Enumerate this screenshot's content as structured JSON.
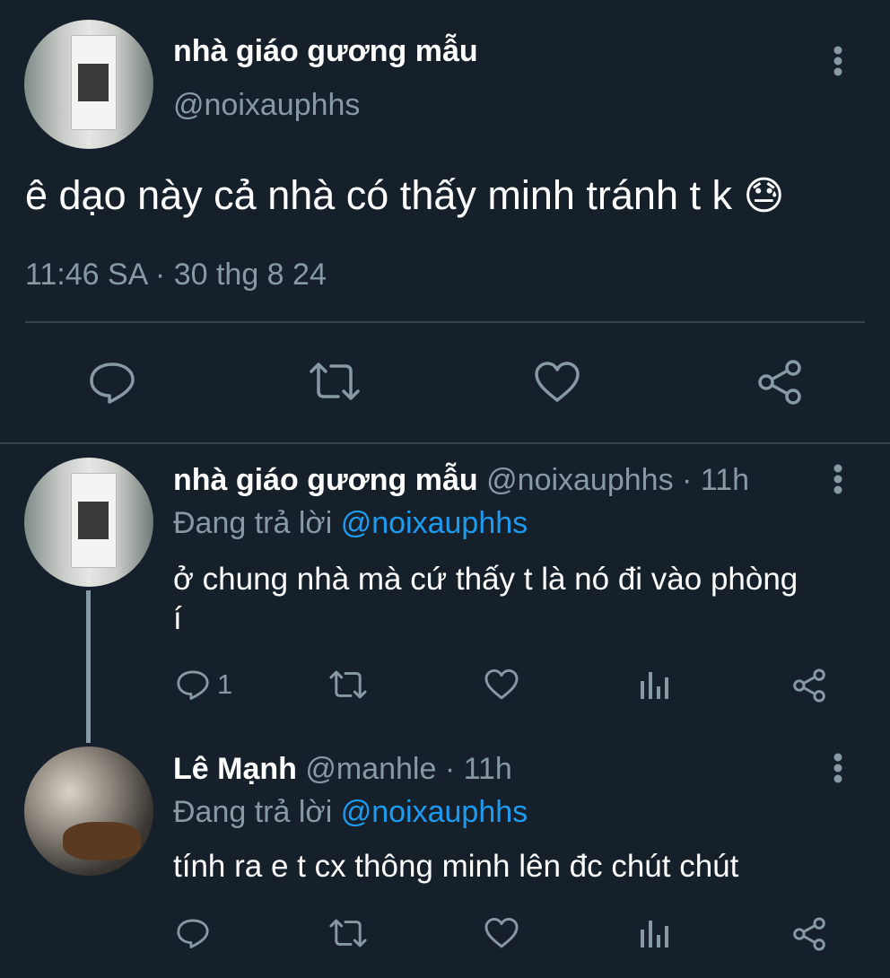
{
  "main_tweet": {
    "display_name": "nhà giáo gương mẫu",
    "handle": "@noixauphhs",
    "text": "ê dạo này cả nhà có thấy minh tránh t k",
    "emoji": "😓",
    "timestamp": "11:46 SA · 30 thg 8 24"
  },
  "reply1": {
    "display_name": "nhà giáo gương mẫu",
    "handle": "@noixauphhs",
    "time": "· 11h",
    "replying_prefix": "Đang trả lời",
    "replying_to": "@noixauphhs",
    "text_line1": "ở chung nhà mà cứ thấy t là nó đi vào phòng",
    "text_line2": "í",
    "reply_count": "1"
  },
  "reply2": {
    "display_name": "Lê Mạnh",
    "handle": "@manhle",
    "time": "· 11h",
    "replying_prefix": "Đang trả lời",
    "replying_to": "@noixauphhs",
    "text": "tính ra e t cx thông minh lên đc chút chút"
  },
  "colors": {
    "background": "#15202b",
    "muted": "#8899a6",
    "link": "#1d9bf0",
    "divider": "#38444d"
  }
}
